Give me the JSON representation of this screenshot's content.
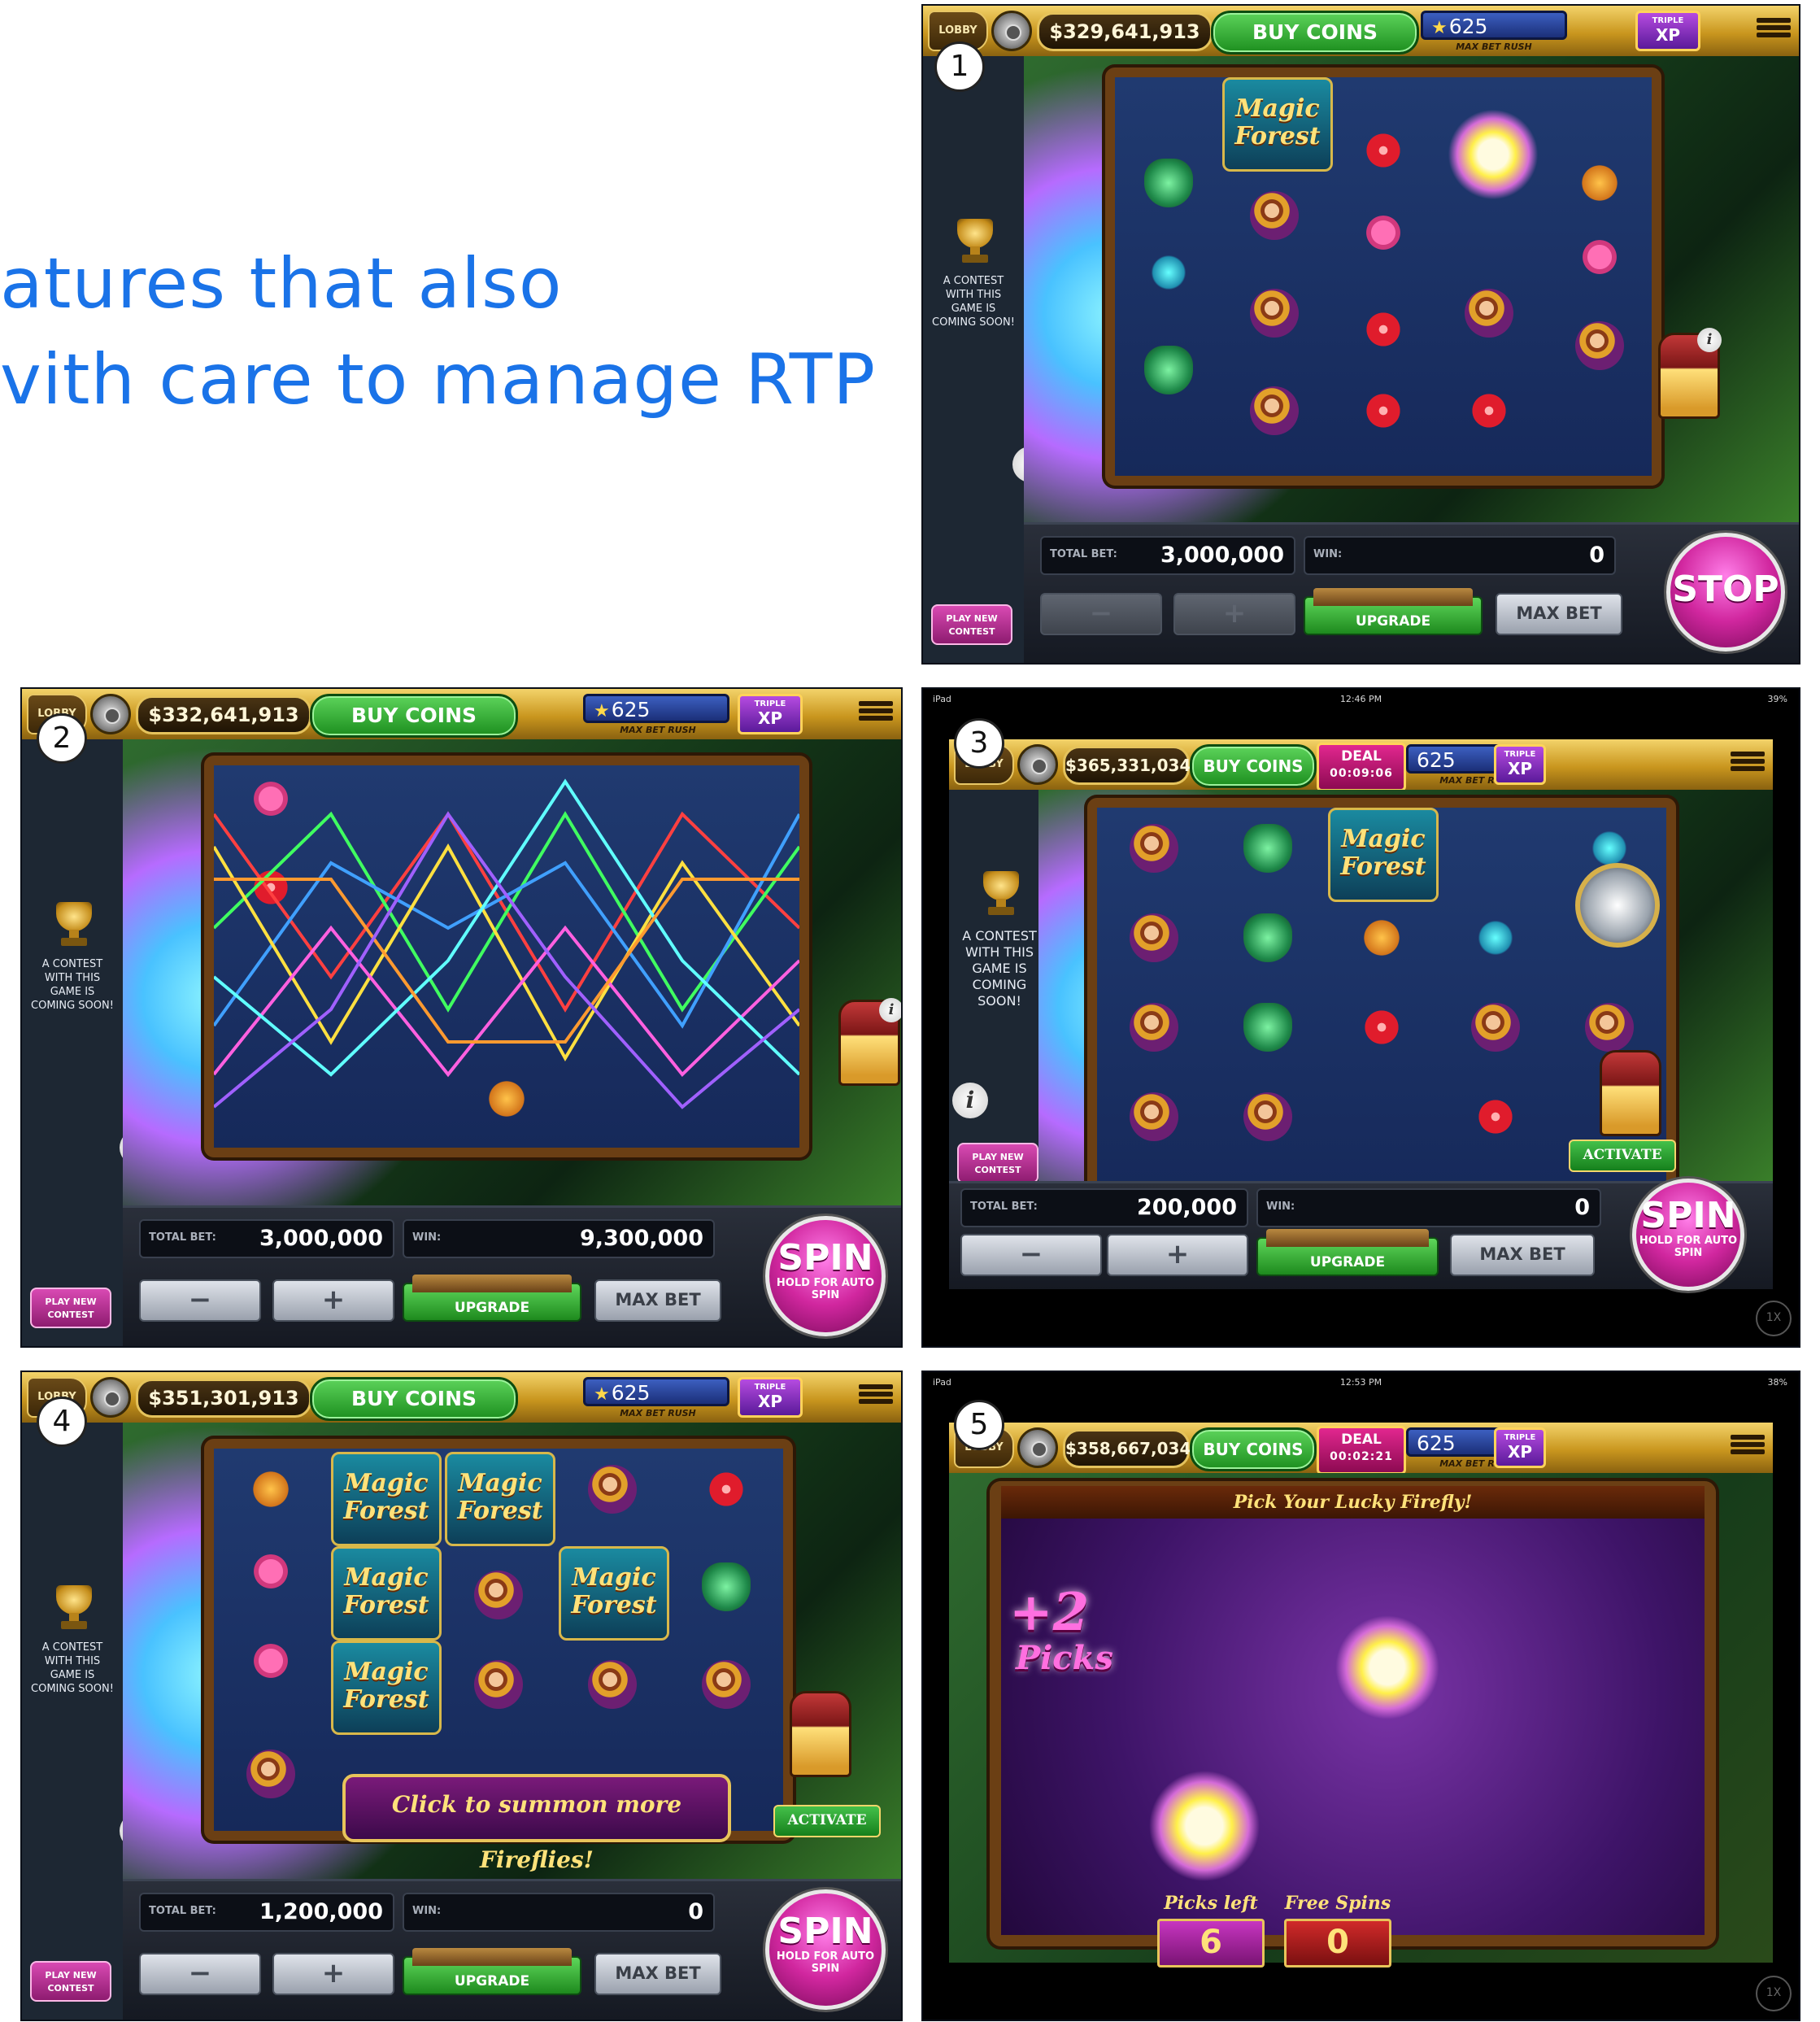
{
  "headline": {
    "line1": "atures that also",
    "line2": "vith care to manage RTP"
  },
  "common": {
    "lobby": "LOBBY",
    "buy_coins": "BUY COINS",
    "xp_level": "625",
    "xp_star": "★",
    "max_bet_rush": "MAX BET RUSH",
    "triple_top": "TRIPLE",
    "triple_bottom": "XP",
    "contest_text": "A CONTEST WITH THIS GAME IS COMING SOON!",
    "play_new_contest": "PLAY NEW CONTEST",
    "total_bet_label": "TOTAL BET:",
    "win_label": "WIN:",
    "minus": "−",
    "plus": "+",
    "upgrade": "UPGRADE",
    "max_bet": "MAX BET",
    "spin": "SPIN",
    "hold_for_auto_spin": "HOLD FOR AUTO SPIN",
    "stop": "STOP",
    "info": "i",
    "one_x": "1X",
    "activate": "ACTIVATE",
    "logo_magic": "Magic",
    "logo_forest": "Forest"
  },
  "shots": [
    {
      "number": "1",
      "balance": "$329,641,913",
      "total_bet": "3,000,000",
      "win": "0",
      "button": "STOP"
    },
    {
      "number": "2",
      "balance": "$332,641,913",
      "total_bet": "3,000,000",
      "win": "9,300,000",
      "button": "SPIN"
    },
    {
      "number": "3",
      "balance": "$365,331,034",
      "total_bet": "200,000",
      "win": "0",
      "button": "SPIN",
      "status_left": "iPad",
      "status_time": "12:46 PM",
      "status_right": "39%",
      "deal_label": "DEAL",
      "deal_timer": "00:09:06"
    },
    {
      "number": "4",
      "balance": "$351,301,913",
      "total_bet": "1,200,000",
      "win": "0",
      "button": "SPIN",
      "summon": "Click to summon more Fireflies!"
    },
    {
      "number": "5",
      "balance": "$358,667,034",
      "status_left": "iPad",
      "status_time": "12:53 PM",
      "status_right": "38%",
      "deal_label": "DEAL",
      "deal_timer": "00:02:21",
      "banner": "Pick Your Lucky Firefly!",
      "plus_picks_num": "+2",
      "plus_picks_word": "Picks",
      "picks_left_label": "Picks left",
      "picks_left_value": "6",
      "free_spins_label": "Free Spins",
      "free_spins_value": "0"
    }
  ],
  "colors": {
    "headline": "#1a73e8",
    "spin_magenta": "#d1279f",
    "buy_coins_green": "#1d8f1f",
    "gold_bar": "#c9961e"
  },
  "icons": [
    "gear-icon",
    "star-icon",
    "menu-icon",
    "trophy-icon",
    "info-icon",
    "compass-icon",
    "lantern-icon",
    "firefly-icon"
  ]
}
